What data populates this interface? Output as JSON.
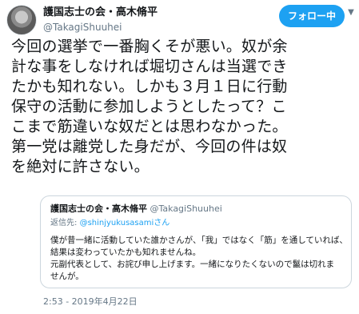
{
  "header": {
    "display_name": "護国志士の会・高木脩平",
    "handle": "@TakagiShuuhei",
    "follow_label": "フォロー中",
    "more_icon": "chevron-down-icon"
  },
  "tweet": {
    "lines": [
      "今回の選挙で一番胸くそが悪い。奴が余",
      "計な事をしなければ堀切さんは当選でき",
      "たかも知れない。しかも３月１日に行動",
      "保守の活動に参加しようとしたって？こ",
      "こまで筋違いな奴だとは思わなかった。",
      "第一党は離党した身だが、今回の件は奴",
      "を絶対に許さない。"
    ],
    "timestamp": "2:53 - 2019年4月22日"
  },
  "quoted": {
    "display_name": "護国志士の会・高木脩平",
    "handle": "@TakagiShuuhei",
    "reply_prefix": "返信先: ",
    "reply_to": "@shinjyukusasamiさん",
    "body_lines": [
      "僕が昔一緒に活動していた誰かさんが、「我」ではなく「筋」を通していれば、",
      "結果は変わっていたかも知れませんね。",
      "元副代表として、お詫び申し上げます。一緒になりたくないので鬣は切れま",
      "せんが。"
    ]
  },
  "colors": {
    "accent": "#1da1f2",
    "text": "#14171a",
    "muted": "#657786",
    "border": "#ccd6dd"
  }
}
